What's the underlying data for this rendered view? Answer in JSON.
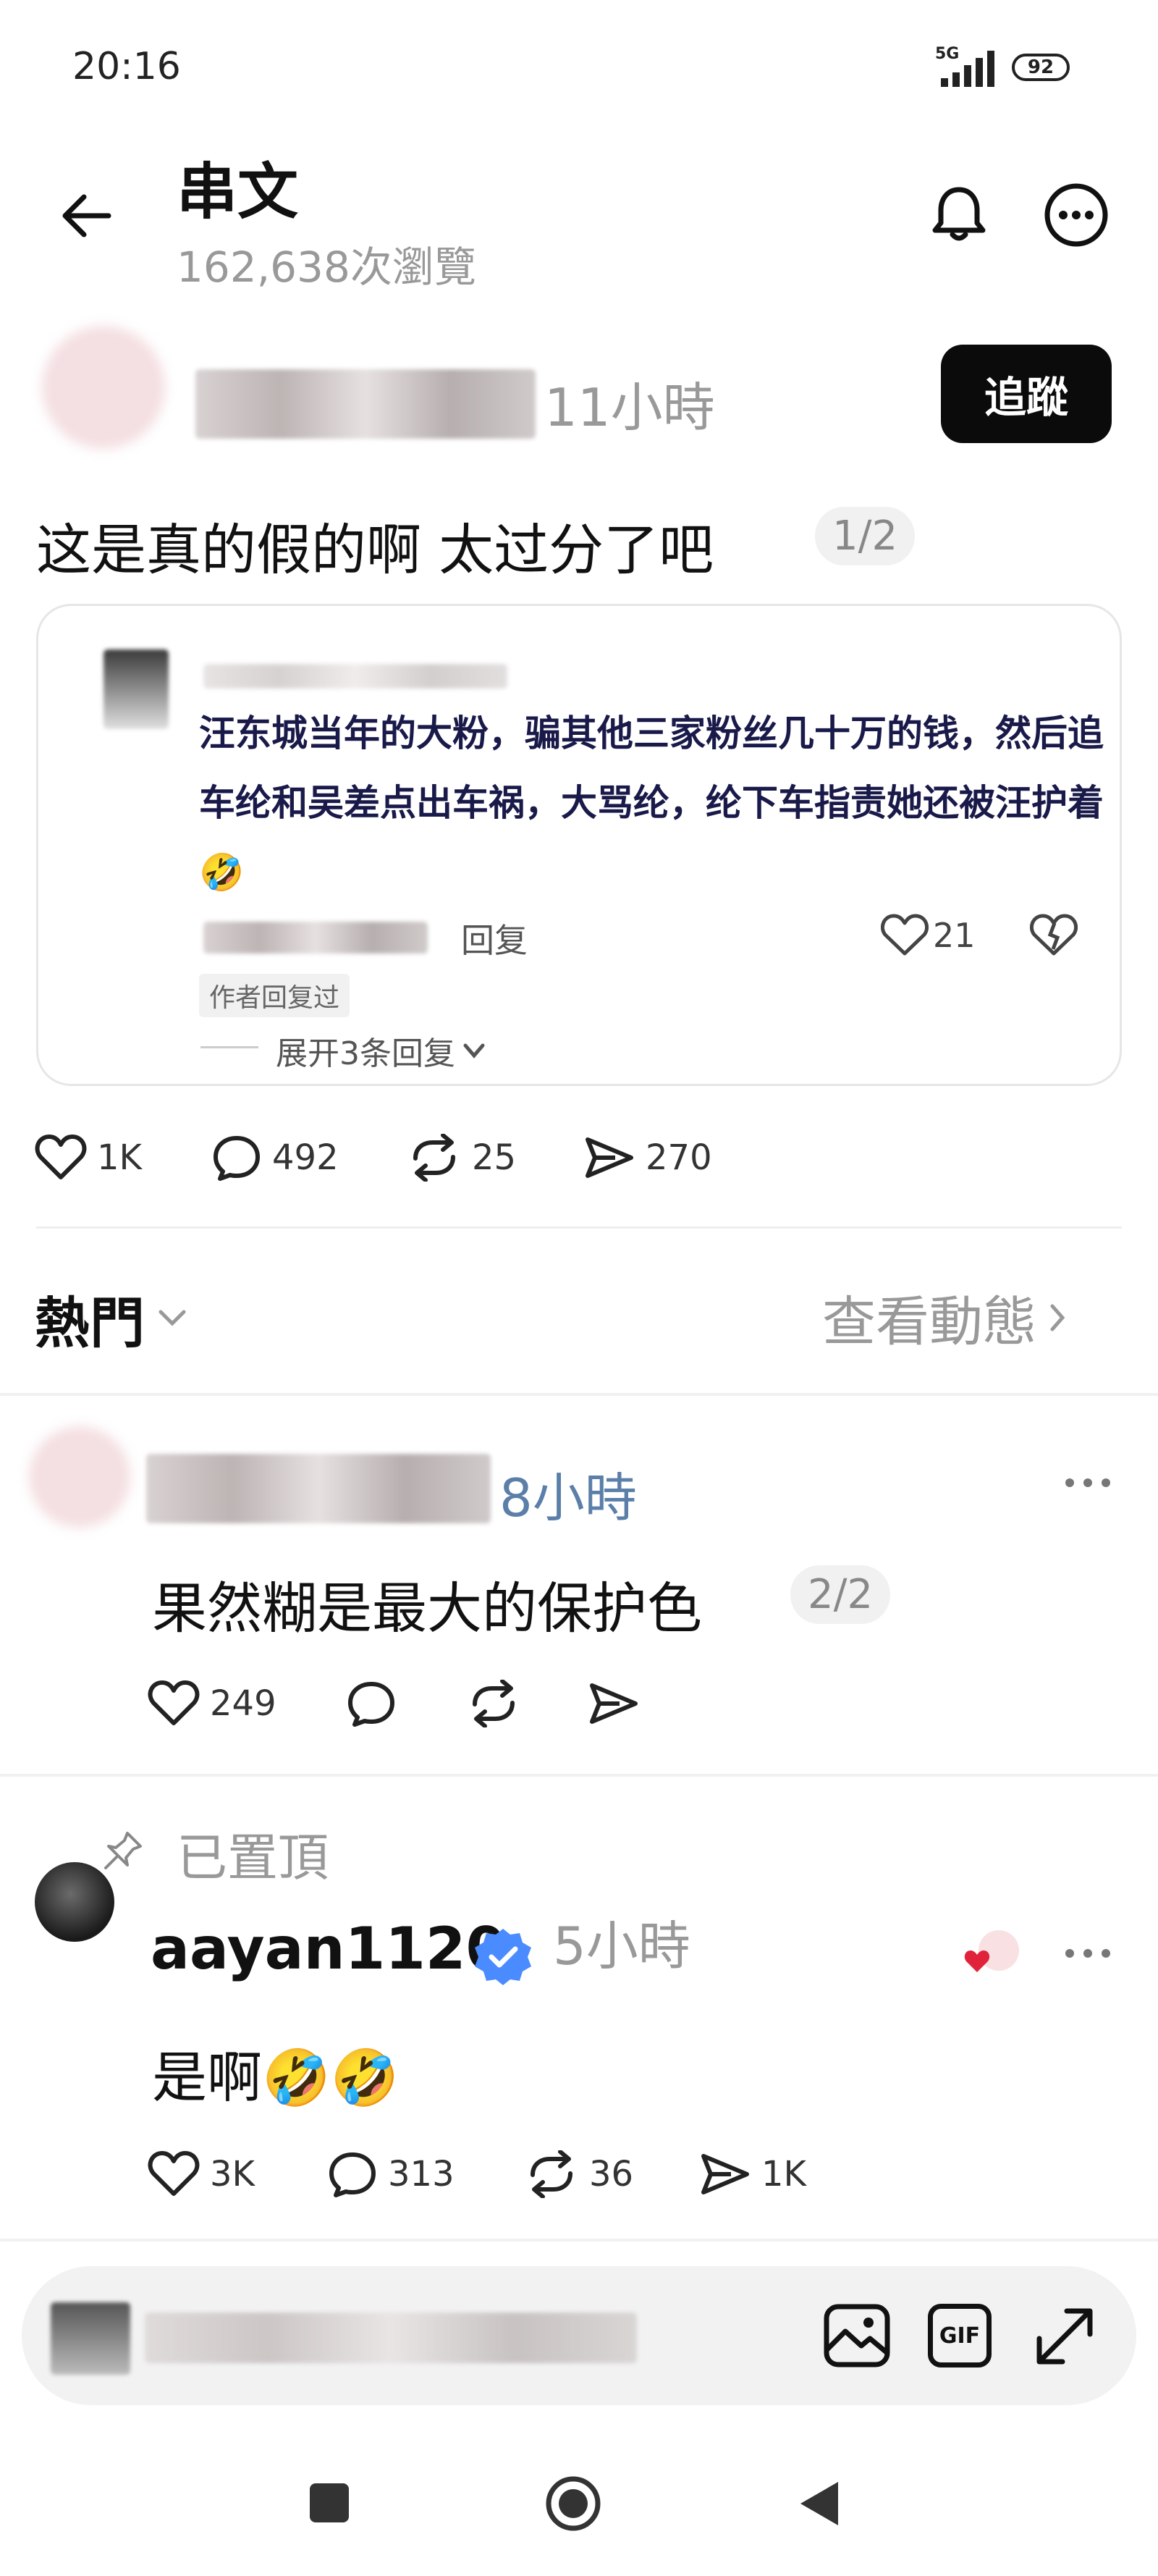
{
  "status_bar": {
    "time": "20:16",
    "network": "5G",
    "battery": "92"
  },
  "header": {
    "title": "串文",
    "views": "162,638次瀏覽"
  },
  "post": {
    "time": "11小時",
    "follow_label": "追蹤",
    "text": "这是真的假的啊 太过分了吧",
    "page_indicator": "1/2",
    "embed": {
      "text": "汪东城当年的大粉，骗其他三家粉丝几十万的钱，然后追车纶和吴差点出车祸，大骂纶，纶下车指责她还被汪护着🤣",
      "reply_label": "回复",
      "like_count": "21",
      "author_replied": "作者回复过",
      "expand_label": "展开3条回复"
    },
    "stats": {
      "likes": "1K",
      "comments": "492",
      "reposts": "25",
      "shares": "270"
    }
  },
  "sort": {
    "label": "熱門",
    "activity_link": "查看動態"
  },
  "replies": [
    {
      "time": "8小時",
      "text": "果然糊是最大的保护色",
      "page_indicator": "2/2",
      "stats": {
        "likes": "249"
      }
    },
    {
      "pinned_label": "已置頂",
      "username": "aayan1120",
      "time": "5小時",
      "text": "是啊🤣🤣",
      "stats": {
        "likes": "3K",
        "comments": "313",
        "reposts": "36",
        "shares": "1K"
      }
    }
  ],
  "composer": {
    "gif_label": "GIF"
  }
}
